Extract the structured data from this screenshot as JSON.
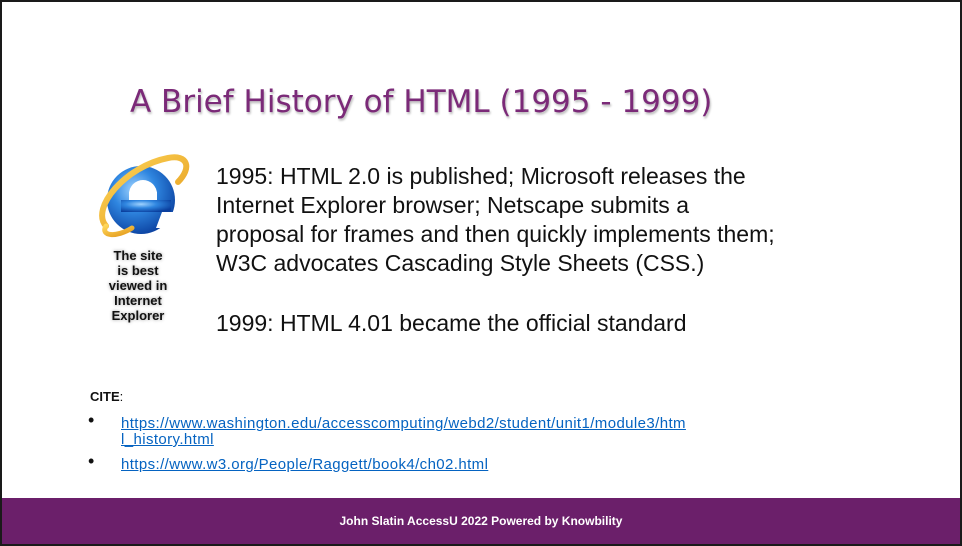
{
  "slide": {
    "title": "A Brief History of HTML (1995 - 1999)",
    "ie_badge": {
      "icon": "internet-explorer-logo",
      "caption_lines": [
        "The site",
        "is best",
        "viewed in",
        "Internet",
        "Explorer"
      ]
    },
    "paragraphs": [
      {
        "lines": [
          "1995: HTML 2.0 is published; Microsoft releases the",
          "Internet Explorer browser;  Netscape submits a",
          "proposal for frames and then quickly implements them;",
          "W3C advocates Cascading Style Sheets (CSS.)"
        ]
      },
      {
        "lines": [
          "1999: HTML 4.01 became the official standard"
        ]
      }
    ],
    "cite": {
      "label": "CITE",
      "colon": ":",
      "links": [
        {
          "line1": "https://www.washington.edu/accesscomputing/webd2/student/unit1/module3/htm",
          "line2": "l_history.html"
        },
        {
          "line1": "https://www.w3.org/People/Raggett/book4/ch02.html"
        }
      ]
    },
    "footer": "John Slatin AccessU 2022 Powered by Knowbility"
  },
  "colors": {
    "title": "#7b2a78",
    "footer_bg": "#6b1f6a",
    "link": "#0563c1"
  }
}
